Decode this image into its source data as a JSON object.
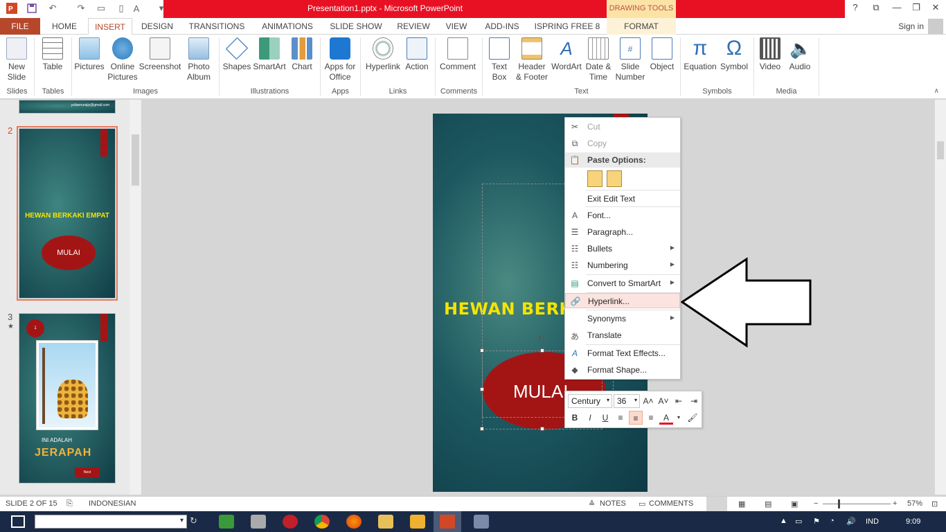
{
  "titlebar": {
    "title": "Presentation1.pptx -  Microsoft PowerPoint",
    "context_tools": "DRAWING TOOLS"
  },
  "tabs": [
    {
      "label": "FILE"
    },
    {
      "label": "HOME"
    },
    {
      "label": "INSERT"
    },
    {
      "label": "DESIGN"
    },
    {
      "label": "TRANSITIONS"
    },
    {
      "label": "ANIMATIONS"
    },
    {
      "label": "SLIDE SHOW"
    },
    {
      "label": "REVIEW"
    },
    {
      "label": "VIEW"
    },
    {
      "label": "ADD-INS"
    },
    {
      "label": "ISPRING FREE 8"
    },
    {
      "label": "FORMAT"
    }
  ],
  "signin": "Sign in",
  "ribbon": {
    "buttons": [
      {
        "label": "New\nSlide"
      },
      {
        "label": "Table"
      },
      {
        "label": "Pictures"
      },
      {
        "label": "Online\nPictures"
      },
      {
        "label": "Screenshot"
      },
      {
        "label": "Photo\nAlbum"
      },
      {
        "label": "Shapes"
      },
      {
        "label": "SmartArt"
      },
      {
        "label": "Chart"
      },
      {
        "label": "Apps for\nOffice"
      },
      {
        "label": "Hyperlink"
      },
      {
        "label": "Action"
      },
      {
        "label": "Comment"
      },
      {
        "label": "Text\nBox"
      },
      {
        "label": "Header\n& Footer"
      },
      {
        "label": "WordArt"
      },
      {
        "label": "Date &\nTime"
      },
      {
        "label": "Slide\nNumber"
      },
      {
        "label": "Object"
      },
      {
        "label": "Equation"
      },
      {
        "label": "Symbol"
      },
      {
        "label": "Video"
      },
      {
        "label": "Audio"
      }
    ],
    "groups": [
      {
        "label": "Slides"
      },
      {
        "label": "Tables"
      },
      {
        "label": "Images"
      },
      {
        "label": "Illustrations"
      },
      {
        "label": "Apps"
      },
      {
        "label": "Links"
      },
      {
        "label": "Comments"
      },
      {
        "label": "Text"
      },
      {
        "label": "Symbols"
      },
      {
        "label": "Media"
      }
    ]
  },
  "slides_panel": {
    "slide1_email": "yuliaenurajiy@gmail.com",
    "slide2": {
      "number": "2",
      "title": "HEWAN BERKAKI EMPAT",
      "button": "MULAI"
    },
    "slide3": {
      "number": "3",
      "star": "★",
      "badge": "1",
      "subtitle": "INI ADALAH",
      "title": "JERAPAH",
      "next": "Next"
    }
  },
  "slide": {
    "title": "HEWAN BERKAKI",
    "button": "MULAI"
  },
  "context_menu": {
    "cut": "Cut",
    "copy": "Copy",
    "paste_options": "Paste Options:",
    "exit_edit_text": "Exit Edit Text",
    "font": "Font...",
    "paragraph": "Paragraph...",
    "bullets": "Bullets",
    "numbering": "Numbering",
    "convert_smartart": "Convert to SmartArt",
    "hyperlink": "Hyperlink...",
    "synonyms": "Synonyms",
    "translate": "Translate",
    "format_text_effects": "Format Text Effects...",
    "format_shape": "Format Shape..."
  },
  "mini_toolbar": {
    "font": "Century",
    "size": "36",
    "bold": "B",
    "italic": "I",
    "underline": "U"
  },
  "statusbar": {
    "slide_info": "SLIDE 2 OF 15",
    "language": "INDONESIAN",
    "notes": "NOTES",
    "comments": "COMMENTS",
    "zoom": "57%"
  },
  "taskbar": {
    "lang": "IND",
    "time": "9:09"
  },
  "colors": {
    "accent": "#b7472a",
    "titlebar": "#e81123",
    "slide_title": "#f5e400",
    "oval": "#a31515",
    "hover": "#fbe3df"
  }
}
